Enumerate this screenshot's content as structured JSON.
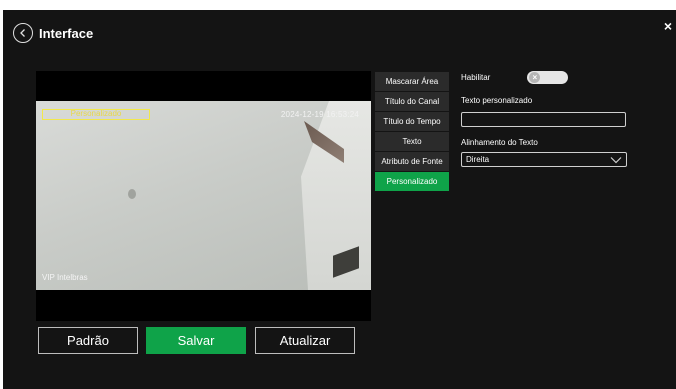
{
  "window": {
    "title": "Interface",
    "close_glyph": "×"
  },
  "preview": {
    "overlay_custom_text": "Personalizado",
    "overlay_timestamp": "2024-12-19 16:53:24",
    "overlay_channel_name": "VIP Intelbras",
    "overlay_box_color": "#f2e84a"
  },
  "side_menu": {
    "items": [
      {
        "label": "Mascarar Área"
      },
      {
        "label": "Título do Canal"
      },
      {
        "label": "Título do Tempo"
      },
      {
        "label": "Texto"
      },
      {
        "label": "Atributo de Fonte"
      },
      {
        "label": "Personalizado",
        "active": true
      }
    ],
    "active_color": "#0fa349"
  },
  "settings": {
    "enable_label": "Habilitar",
    "enable_state": false,
    "custom_text_label": "Texto personalizado",
    "custom_text_value": "",
    "alignment_label": "Alinhamento do Texto",
    "alignment_value": "Direita"
  },
  "buttons": {
    "default_label": "Padrão",
    "save_label": "Salvar",
    "refresh_label": "Atualizar"
  },
  "icons": {
    "back": "chevron-left-circle-icon",
    "close": "close-icon",
    "toggle_off": "x-icon",
    "dropdown": "chevron-down-icon"
  }
}
